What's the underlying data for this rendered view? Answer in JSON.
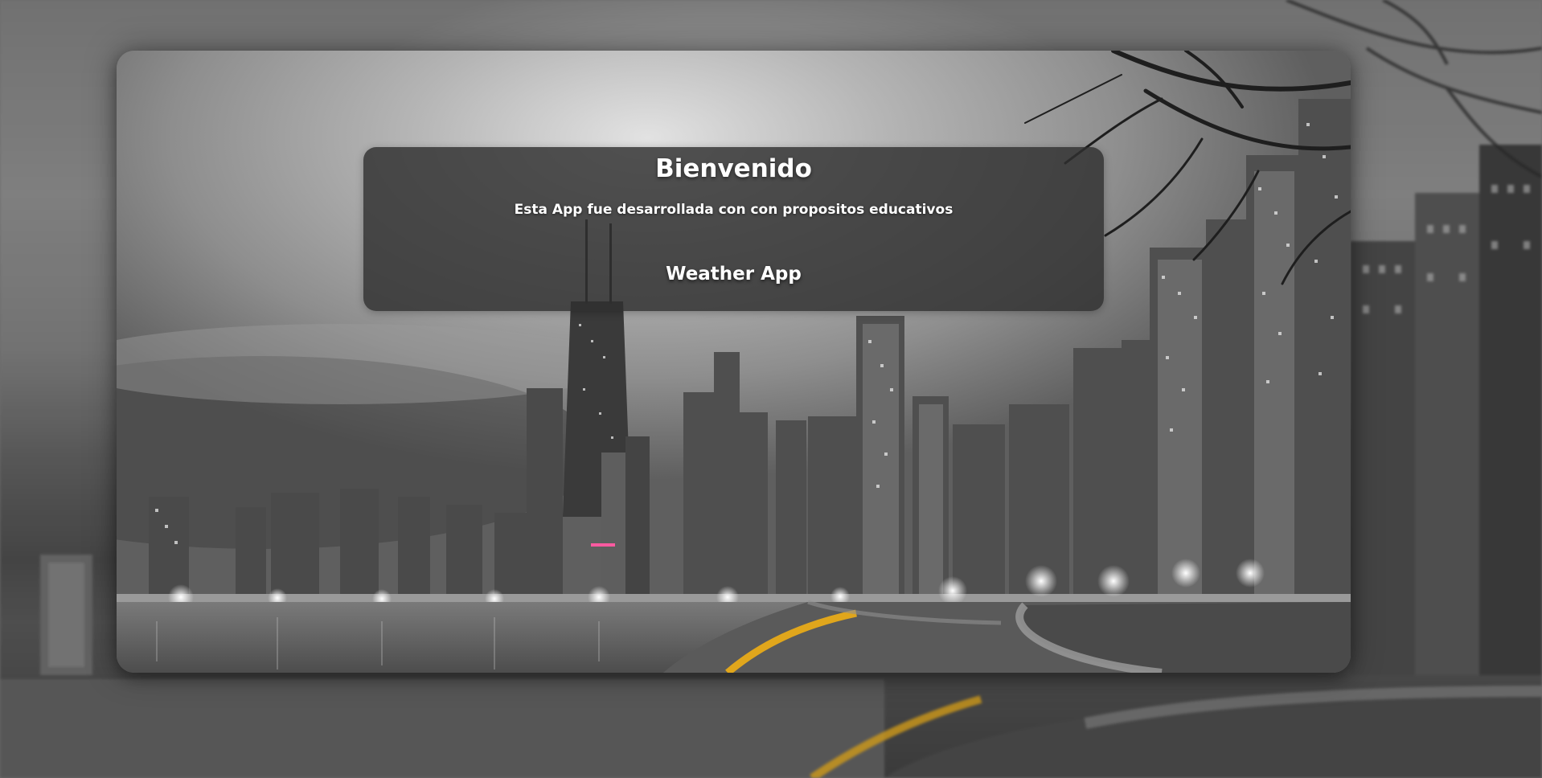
{
  "welcome": {
    "title": "Bienvenido",
    "description": "Esta App fue desarrollada con con propositos educativos",
    "app_name": "Weather App"
  },
  "background": {
    "image": "city-skyline-night-grayscale",
    "accent_color": "#e0a61c"
  }
}
